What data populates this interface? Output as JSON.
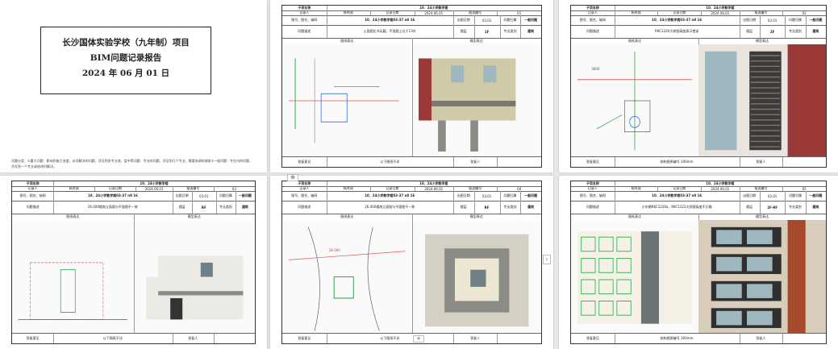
{
  "cover": {
    "title_line1": "长沙国体实验学校（九年制）项目",
    "title_line2": "BIM问题记录报告",
    "date": "2024 年 06 月 01 日",
    "note": "问题分类：①重大问题：影响到施工进度，必须解决的问题，涉及到多专业改，监中等问题：专业的问题，涉及到几个专业，需要协调的调差③一般问题：专业内的问题，涉及到一个专业或修改时解决。"
  },
  "sheet_labels": {
    "subproject": "子项名称",
    "recorder": "记录人",
    "record_date": "记录日期",
    "number": "图号、图名、轴网",
    "problem_desc": "问题描述",
    "problem_type": "问题归属",
    "floor": "楼层",
    "zone": "轴号",
    "major": "专业类别",
    "plan_view": "图纸表达",
    "model_view": "模型表达",
    "opinion": "答复意见",
    "modify_done": "以下图纸不详",
    "replier": "答复人",
    "send_no": "报送编号",
    "date_label": "出图日期"
  },
  "sheets": [
    {
      "project": "10、24小学教学楼",
      "recorder": "杨秀成",
      "date": "2024.06.01",
      "no": "01",
      "drawing": "10、24小学教学楼03-37 n8 16",
      "drawdate": "03.01",
      "level": "一般问题",
      "desc": "士面图比书无疑，平面图上位于13外",
      "floor": "1F",
      "zone": "1-A至1-1E",
      "major": "建筑",
      "footer": "以下图纸不详"
    },
    {
      "project": "10、24小学教学楼",
      "recorder": "杨秀成",
      "date": "2024.06.01",
      "no": "02",
      "drawing": "10、24小学教学楼03-37 n8 16",
      "drawdate": "03.01",
      "level": "一般问题",
      "desc": "RKC1220大样图高度表示错误",
      "floor": "2F",
      "zone": "1-J至1-K",
      "major": "建筑",
      "footer": "结构图原编号 300mm"
    },
    {
      "project": "10、24小学教学楼",
      "recorder": "杨秀成",
      "date": "2024.06.01",
      "no": "03",
      "drawing": "10、24小学教学楼03-37 n8 16",
      "drawdate": "03.01",
      "level": "一般问题",
      "desc": "26.000楼南立面图与平面图不一致",
      "floor": "RF",
      "zone": "1-A至1-C",
      "major": "建筑",
      "footer": "以下图纸不详"
    },
    {
      "project": "10、24小学教学楼",
      "recorder": "杨秀成",
      "date": "2024.06.01",
      "no": "04",
      "drawing": "10、24小学教学楼03-37 n8 16",
      "drawdate": "03.01",
      "level": "一般问题",
      "desc": "26.000楼南立面图与平面图不一致",
      "floor": "RF",
      "zone": "1-A至1-C",
      "major": "建筑",
      "footer": "以下图纸不详"
    },
    {
      "project": "10、24小学教学楼",
      "recorder": "杨秀成",
      "date": "2024.06.01",
      "no": "05",
      "drawing": "10、24小学教学楼03-37 n8 16",
      "drawdate": "03.01",
      "level": "一般问题",
      "desc": "小车棚RKC1220a、RKC1222大样图高度不正确",
      "floor": "2F-RF",
      "zone": "1-J至1-K",
      "major": "建筑",
      "footer": "结构图原编号 300mm"
    }
  ],
  "ui": {
    "add_symbol": "+",
    "next_symbol": "›",
    "move_symbol": "⊕"
  },
  "sketch_text": {
    "elev1": "3600",
    "elev2": "28.000"
  },
  "colors": {
    "wall": "#cfcaa8",
    "wall_dark": "#8b8c86",
    "accent": "#9b3838",
    "window": "#6f7f86",
    "glass": "#9fb8bf",
    "frame": "#ffffff",
    "cad_red": "#e05050",
    "cad_green": "#2aa84a",
    "cad_blue": "#3b6fd6"
  }
}
